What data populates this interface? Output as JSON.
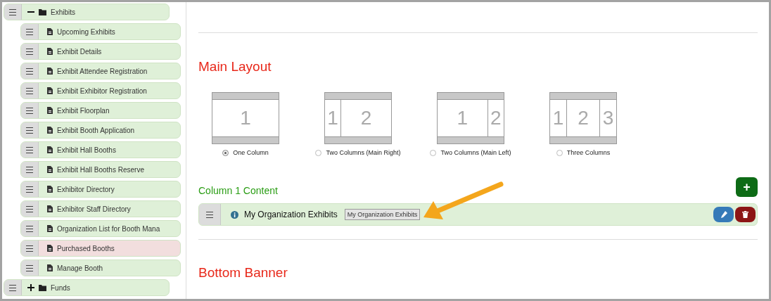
{
  "tree": [
    {
      "label": "Exhibits",
      "kind": "folder",
      "expanded": true,
      "color": "#dff0d8",
      "children": [
        {
          "label": "Upcoming Exhibits",
          "kind": "page",
          "color": "#dff0d8"
        },
        {
          "label": "Exhibit Details",
          "kind": "page",
          "color": "#dff0d8"
        },
        {
          "label": "Exhibit Attendee Registration",
          "kind": "page",
          "color": "#dff0d8"
        },
        {
          "label": "Exhibit Exhibitor Registration",
          "kind": "page",
          "color": "#dff0d8"
        },
        {
          "label": "Exhibit Floorplan",
          "kind": "page",
          "color": "#dff0d8"
        },
        {
          "label": "Exhibit Booth Application",
          "kind": "page",
          "color": "#dff0d8"
        },
        {
          "label": "Exhibit Hall Booths",
          "kind": "page",
          "color": "#dff0d8"
        },
        {
          "label": "Exhibit Hall Booths Reserve",
          "kind": "page",
          "color": "#dff0d8"
        },
        {
          "label": "Exhibitor Directory",
          "kind": "page",
          "color": "#dff0d8"
        },
        {
          "label": "Exhibitor Staff Directory",
          "kind": "page",
          "color": "#dff0d8"
        },
        {
          "label": "Organization List for Booth Mana",
          "kind": "page",
          "color": "#dff0d8"
        },
        {
          "label": "Purchased Booths",
          "kind": "page",
          "color": "#f2dede"
        },
        {
          "label": "Manage Booth",
          "kind": "page",
          "color": "#dff0d8"
        }
      ]
    },
    {
      "label": "Funds",
      "kind": "folder",
      "expanded": false,
      "color": "#dff0d8"
    }
  ],
  "main_layout": {
    "title": "Main Layout",
    "options": [
      {
        "kind": "one",
        "columns": [
          "1"
        ],
        "label": "One Column",
        "selected": true
      },
      {
        "kind": "two-right",
        "columns": [
          "1",
          "2"
        ],
        "label": "Two Columns (Main Right)",
        "selected": false
      },
      {
        "kind": "two-left",
        "columns": [
          "1",
          "2"
        ],
        "label": "Two Columns (Main Left)",
        "selected": false
      },
      {
        "kind": "three",
        "columns": [
          "1",
          "2",
          "3"
        ],
        "label": "Three Columns",
        "selected": false
      }
    ]
  },
  "column_content": {
    "title": "Column 1 Content",
    "add_button": "+",
    "items": [
      {
        "title": "My Organization Exhibits",
        "tag": "My Organization Exhibits"
      }
    ]
  },
  "bottom_banner": {
    "title": "Bottom Banner"
  }
}
